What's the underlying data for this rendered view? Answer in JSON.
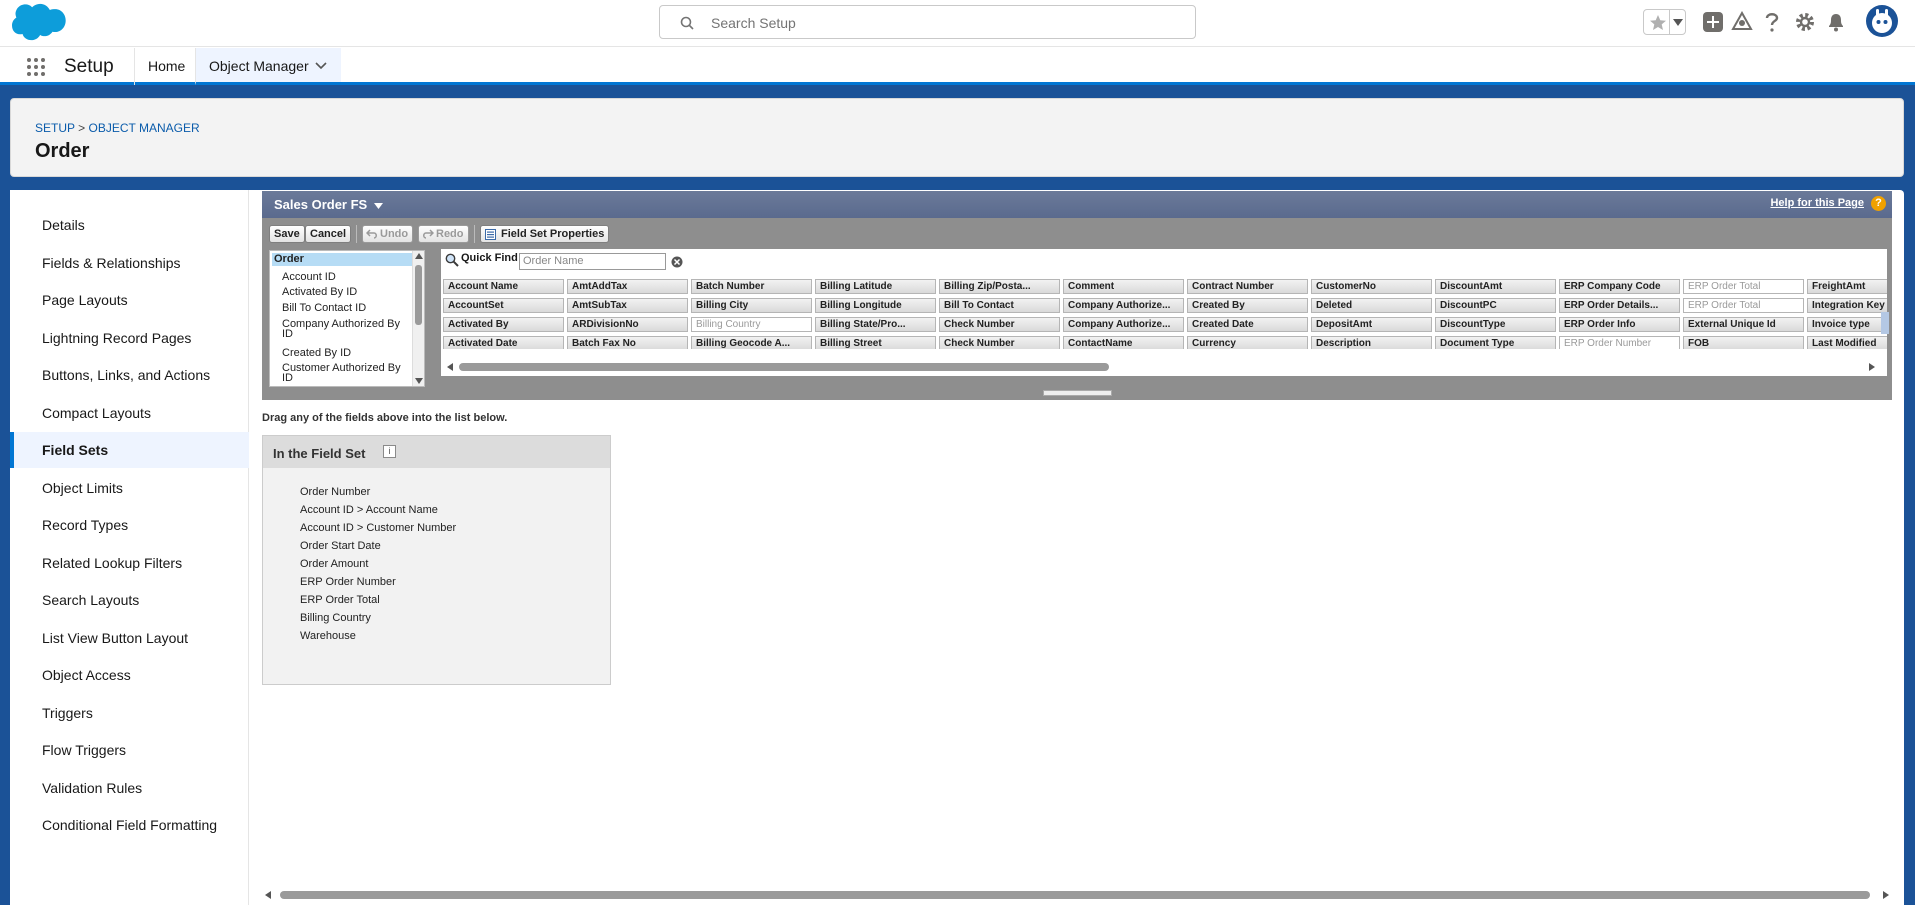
{
  "header": {
    "search_placeholder": "Search Setup"
  },
  "nav": {
    "app_name": "Setup",
    "tabs": [
      {
        "label": "Home"
      },
      {
        "label": "Object Manager"
      }
    ]
  },
  "page": {
    "breadcrumb_setup": "SETUP",
    "breadcrumb_sep": ">",
    "breadcrumb_om": "OBJECT MANAGER",
    "title": "Order"
  },
  "sidebar": {
    "items": [
      {
        "label": "Details"
      },
      {
        "label": "Fields & Relationships"
      },
      {
        "label": "Page Layouts"
      },
      {
        "label": "Lightning Record Pages"
      },
      {
        "label": "Buttons, Links, and Actions"
      },
      {
        "label": "Compact Layouts"
      },
      {
        "label": "Field Sets"
      },
      {
        "label": "Object Limits"
      },
      {
        "label": "Record Types"
      },
      {
        "label": "Related Lookup Filters"
      },
      {
        "label": "Search Layouts"
      },
      {
        "label": "List View Button Layout"
      },
      {
        "label": "Object Access"
      },
      {
        "label": "Triggers"
      },
      {
        "label": "Flow Triggers"
      },
      {
        "label": "Validation Rules"
      },
      {
        "label": "Conditional Field Formatting"
      }
    ],
    "active_index": 6
  },
  "editor": {
    "title": "Sales Order FS",
    "help_link": "Help for this Page",
    "toolbar": {
      "save": "Save",
      "cancel": "Cancel",
      "undo": "Undo",
      "redo": "Redo",
      "properties": "Field Set Properties"
    },
    "tree": {
      "root": "Order",
      "items": [
        "Account ID",
        "Activated By ID",
        "Bill To Contact ID",
        "Company Authorized By",
        "ID",
        "Created By ID",
        "Customer Authorized By",
        "ID"
      ]
    },
    "quick_find_label": "Quick Find",
    "quick_find_placeholder": "Order Name",
    "palette_rows": [
      [
        "Account Name",
        "AmtAddTax",
        "Batch Number",
        "Billing Latitude",
        "Billing Zip/Posta...",
        "Comment",
        "Contract Number",
        "CustomerNo",
        "DiscountAmt",
        "ERP Company Code",
        "ERP Order Total",
        "FreightAmt"
      ],
      [
        "AccountSet",
        "AmtSubTax",
        "Billing City",
        "Billing Longitude",
        "Bill To Contact",
        "Company Authorize...",
        "Created By",
        "Deleted",
        "DiscountPC",
        "ERP Order Details...",
        "ERP Order Total",
        "Integration Key"
      ],
      [
        "Activated By",
        "ARDivisionNo",
        "Billing Country",
        "Billing State/Pro...",
        "Check Number",
        "Company Authorize...",
        "Created Date",
        "DepositAmt",
        "DiscountType",
        "ERP Order Info",
        "External Unique Id",
        "Invoice type"
      ],
      [
        "Activated Date",
        "Batch Fax No",
        "Billing Geocode A...",
        "Billing Street",
        "Check Number",
        "ContactName",
        "Currency",
        "Description",
        "Document Type",
        "ERP Order Number",
        "FOB",
        "Last Modified"
      ]
    ],
    "used_fields": [
      "Billing Country",
      "ERP Order Number",
      "ERP Order Total"
    ]
  },
  "drag_instruction": "Drag any of the fields above into the list below.",
  "field_set": {
    "title": "In the Field Set",
    "info_icon": "i",
    "items": [
      "Order Number",
      "Account ID > Account Name",
      "Account ID > Customer Number",
      "Order Start Date",
      "Order Amount",
      "ERP Order Number",
      "ERP Order Total",
      "Billing Country",
      "Warehouse"
    ]
  },
  "colors": {
    "brand_blue": "#0176d3",
    "background_blue": "#1b5297",
    "editor_header": "#5a6a8e"
  }
}
